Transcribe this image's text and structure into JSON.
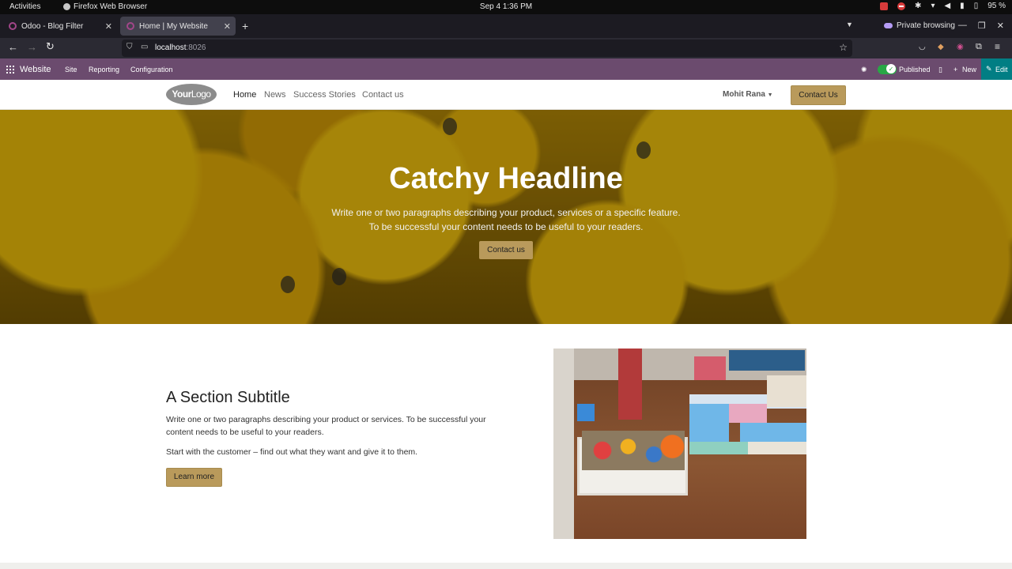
{
  "gnome_bar": {
    "activities": "Activities",
    "app_name": "Firefox Web Browser",
    "clock": "Sep 4  1:36 PM",
    "battery": "95 %"
  },
  "tabs": [
    {
      "title": "Odoo - Blog Filter",
      "active": false
    },
    {
      "title": "Home | My Website",
      "active": true
    }
  ],
  "browser": {
    "private_label": "Private browsing",
    "url_host": "localhost",
    "url_port": ":8026"
  },
  "odoo_bar": {
    "app": "Website",
    "menu": [
      "Site",
      "Reporting",
      "Configuration"
    ],
    "published": "Published",
    "new": "New",
    "edit": "Edit"
  },
  "site_header": {
    "logo_bold": "Your",
    "logo_light": "Logo",
    "menu": [
      "Home",
      "News",
      "Success Stories",
      "Contact us"
    ],
    "user": "Mohit Rana",
    "cta": "Contact Us"
  },
  "hero": {
    "title": "Catchy Headline",
    "line1": "Write one or two paragraphs describing your product, services or a specific feature.",
    "line2": "To be successful your content needs to be useful to your readers.",
    "button": "Contact us"
  },
  "section": {
    "title": "A Section Subtitle",
    "p1": "Write one or two paragraphs describing your product or services. To be successful your content needs to be useful to your readers.",
    "p2": "Start with the customer – find out what they want and give it to them.",
    "button": "Learn more"
  },
  "colors": {
    "odoo_bar": "#6b4b6e",
    "accent_button": "#b99a5b",
    "edit_button": "#017e84",
    "toggle_on": "#28a745"
  }
}
